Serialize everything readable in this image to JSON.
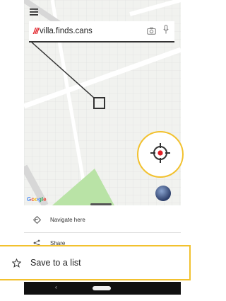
{
  "search": {
    "prefix": "///",
    "address": "villa.finds.cans"
  },
  "map": {
    "street_label": "",
    "attribution": "Google",
    "park_color": "#b9e3a6"
  },
  "actions": {
    "navigate_label": "Navigate here",
    "share_label": "Share",
    "save_label": "Save to a list"
  },
  "navbar": {
    "back_glyph": "‹"
  },
  "colors": {
    "accent_red": "#e11f26",
    "callout_yellow": "#f2c12e"
  },
  "icons": [
    "menu-icon",
    "camera-icon",
    "mic-icon",
    "locate-crosshair-icon",
    "navigate-icon",
    "share-icon",
    "star-icon"
  ]
}
